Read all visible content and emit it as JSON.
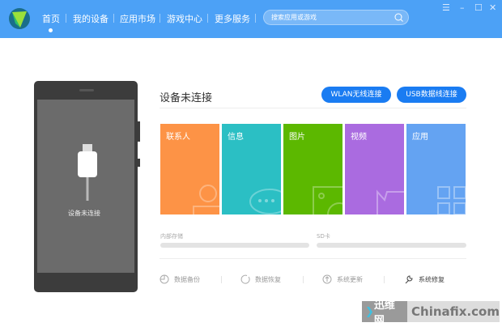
{
  "header": {
    "nav": [
      "首页",
      "我的设备",
      "应用市场",
      "游戏中心",
      "更多服务"
    ],
    "active": 0,
    "search_placeholder": "搜索应用或游戏",
    "controls": [
      "menu",
      "minimize",
      "maximize",
      "close"
    ]
  },
  "phone": {
    "status": "设备未连接"
  },
  "main": {
    "title": "设备未连接",
    "wlan_button": "WLAN无线连接",
    "usb_button": "USB数据线连接",
    "tiles": [
      {
        "label": "联系人",
        "color": "#fd9346"
      },
      {
        "label": "信息",
        "color": "#2bbfc4"
      },
      {
        "label": "图片",
        "color": "#5cb800"
      },
      {
        "label": "视频",
        "color": "#aa6be0"
      },
      {
        "label": "应用",
        "color": "#64a3f2"
      }
    ],
    "storage": [
      {
        "label": "内部存储"
      },
      {
        "label": "SD卡"
      }
    ],
    "actions": [
      "数据备份",
      "数据恢复",
      "系统更新",
      "系统修复"
    ]
  },
  "watermark": {
    "cn": "迅维网",
    "en": "Chinafix.com"
  }
}
